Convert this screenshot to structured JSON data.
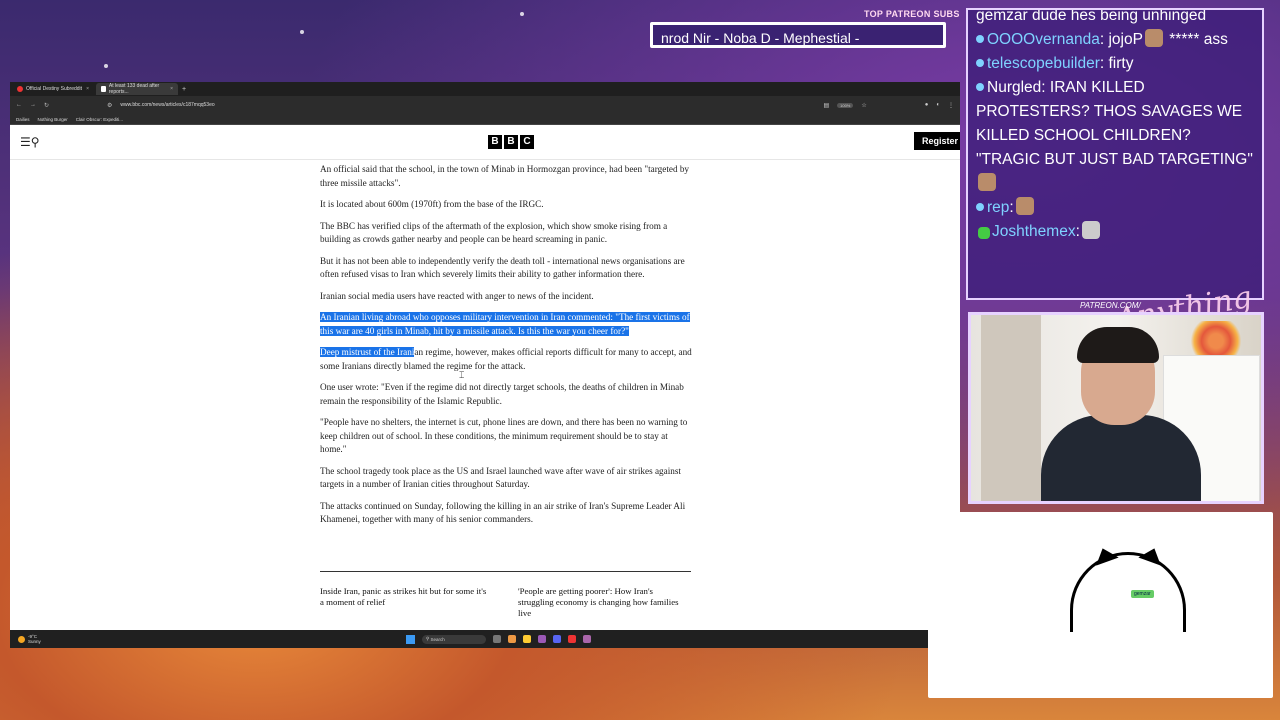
{
  "stream": {
    "patreon_subs_label": "TOP PATREON SUBS",
    "ticker_text": "nrod Nir - Noba D - Mephestial -",
    "patreon_url": "PATREON.COM/",
    "signature": "Anything Else"
  },
  "browser": {
    "tabs": [
      {
        "label": "Official Destiny Subreddit"
      },
      {
        "label": "At least 133 dead after reports..."
      }
    ],
    "url": "www.bbc.com/news/articles/c187mqq53eo",
    "zoom": "100%",
    "bookmarks": [
      "Dailies",
      "Nothing Burger",
      "Clair Obscur: Expediti..."
    ]
  },
  "bbc": {
    "logo_letters": [
      "B",
      "B",
      "C"
    ],
    "register_label": "Register"
  },
  "article": {
    "p1": "An official said that the school, in the town of Minab in Hormozgan province, had been \"targeted by three missile attacks\".",
    "p2": "It is located about 600m (1970ft) from the base of the IRGC.",
    "p3": "The BBC has verified clips of the aftermath of the explosion, which show smoke rising from a building as crowds gather nearby and people can be heard screaming in panic.",
    "p4": "But it has not been able to independently verify the death toll - international news organisations are often refused visas to Iran which severely limits their ability to gather information there.",
    "p5": "Iranian social media users have reacted with anger to news of the incident.",
    "p6": "An Iranian living abroad who opposes military intervention in Iran commented: \"The first victims of this war are 40 girls in Minab, hit by a missile attack. Is this the war you cheer for?\"",
    "p7_highlight": "Deep mistrust of the Irani",
    "p7_rest": "an regime, however, makes official reports difficult for many to accept, and some Iranians directly blamed the regime for the attack.",
    "p8": "One user wrote: \"Even if the regime did not directly target schools, the deaths of children in Minab remain the responsibility of the Islamic Republic.",
    "p9": "\"People have no shelters, the internet is cut, phone lines are down, and there has been no warning to keep children out of school. In these conditions, the minimum requirement should be to stay at home.\"",
    "p10": "The school tragedy took place as the US and Israel launched wave after wave of air strikes against targets in a number of Iranian cities throughout Saturday.",
    "p11": "The attacks continued on Sunday, following the killing in an air strike of Iran's Supreme Leader Ali Khamenei, together with many of his senior commanders."
  },
  "related": [
    "Inside Iran, panic as strikes hit but for some it's a moment of relief",
    "'People are getting poorer': How Iran's struggling economy is changing how families live"
  ],
  "taskbar": {
    "temp": "-9°C",
    "weather": "Sunny",
    "search_placeholder": "Search"
  },
  "chat": [
    {
      "user": "",
      "text": "gemzar dude hes being unhinged",
      "partial": true
    },
    {
      "user": "OOOOvernanda",
      "text": ": jojoP",
      "suffix": "***** ass"
    },
    {
      "user": "telescopebuilder",
      "text": ": firty"
    },
    {
      "user": "Nurgled",
      "text": ": IRAN KILLED PROTESTERS? THOS SAVAGES WE KILLED SCHOOL CHILDREN? \"TRAGIC BUT JUST BAD TARGETING\""
    },
    {
      "user": "rep",
      "text": ":"
    },
    {
      "user": "Joshthemex",
      "text": ":"
    }
  ],
  "bongo": {
    "tag": "gemzar"
  }
}
